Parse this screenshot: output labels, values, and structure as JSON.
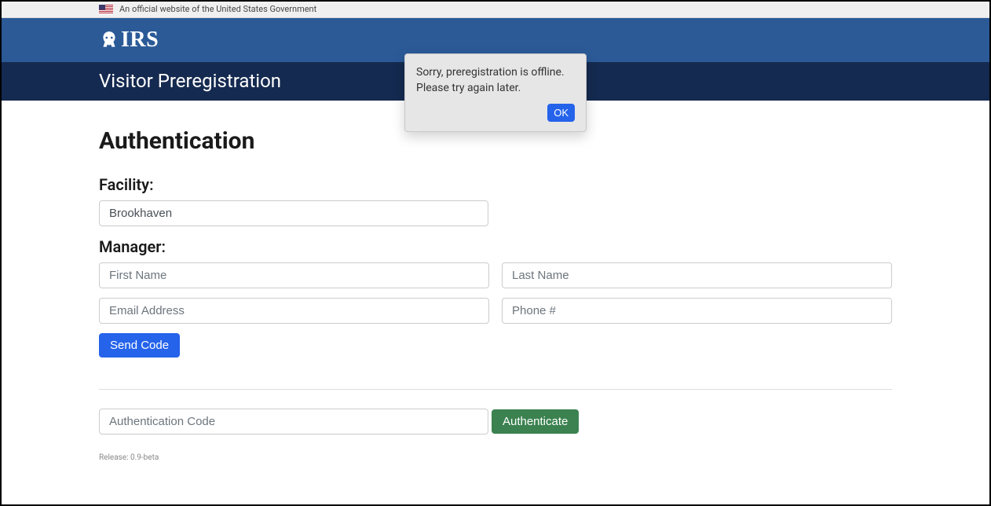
{
  "banner": {
    "text": "An official website of the United States Government"
  },
  "header": {
    "logo_text": "IRS",
    "subtitle": "Visitor Preregistration"
  },
  "modal": {
    "line1": "Sorry, preregistration is offline.",
    "line2": "Please try again later.",
    "ok_label": "OK"
  },
  "auth": {
    "heading": "Authentication",
    "facility_label": "Facility:",
    "facility_value": "Brookhaven",
    "manager_label": "Manager:",
    "first_name_placeholder": "First Name",
    "last_name_placeholder": "Last Name",
    "email_placeholder": "Email Address",
    "phone_placeholder": "Phone #",
    "send_code_label": "Send Code",
    "auth_code_placeholder": "Authentication Code",
    "authenticate_label": "Authenticate"
  },
  "footer": {
    "release_text": "Release: 0.9-beta"
  }
}
